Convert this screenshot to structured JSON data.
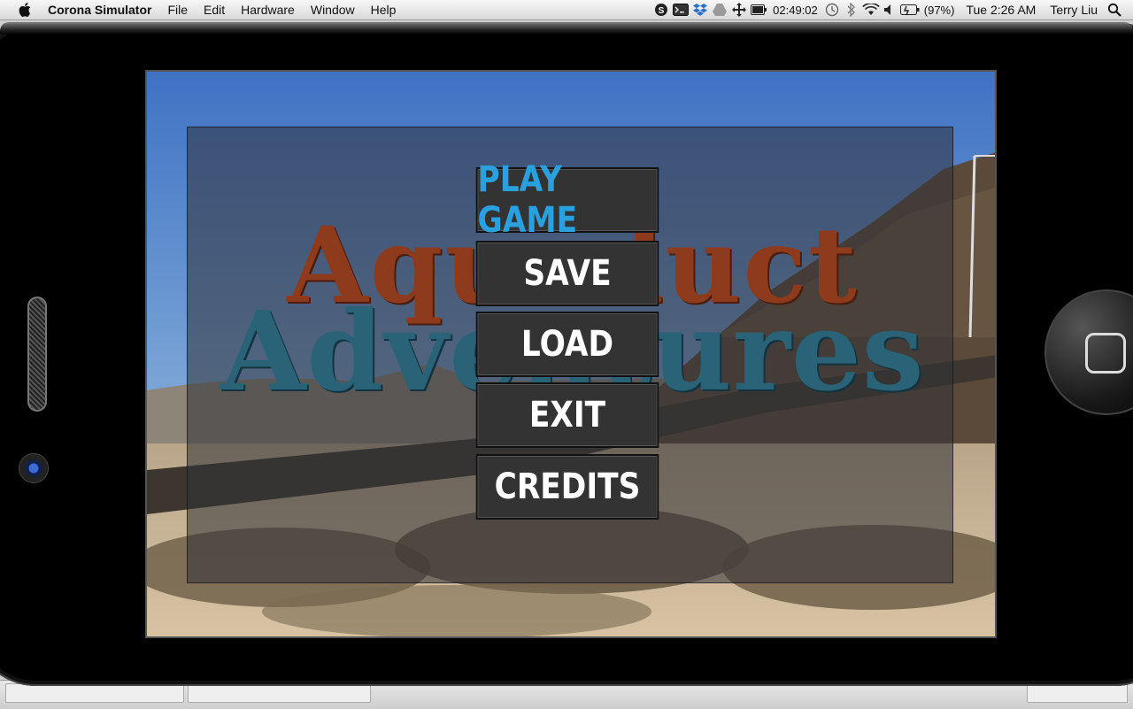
{
  "menubar": {
    "app_name": "Corona Simulator",
    "items": [
      "File",
      "Edit",
      "Hardware",
      "Window",
      "Help"
    ],
    "status_timer": "02:49:02",
    "battery": "(97%)",
    "clock": "Tue 2:26 AM",
    "user": "Terry Liu"
  },
  "game": {
    "title_line1": "Aqueduct",
    "title_line2": "Adventures",
    "menu": [
      {
        "label": "PLAY GAME",
        "active": true
      },
      {
        "label": "SAVE",
        "active": false
      },
      {
        "label": "LOAD",
        "active": false
      },
      {
        "label": "EXIT",
        "active": false
      },
      {
        "label": "CREDITS",
        "active": false
      }
    ],
    "colors": {
      "active_button_text": "#2aa1df",
      "button_bg": "#333333",
      "title_line1": "#8e3b1d",
      "title_line2": "#2a6378"
    }
  }
}
